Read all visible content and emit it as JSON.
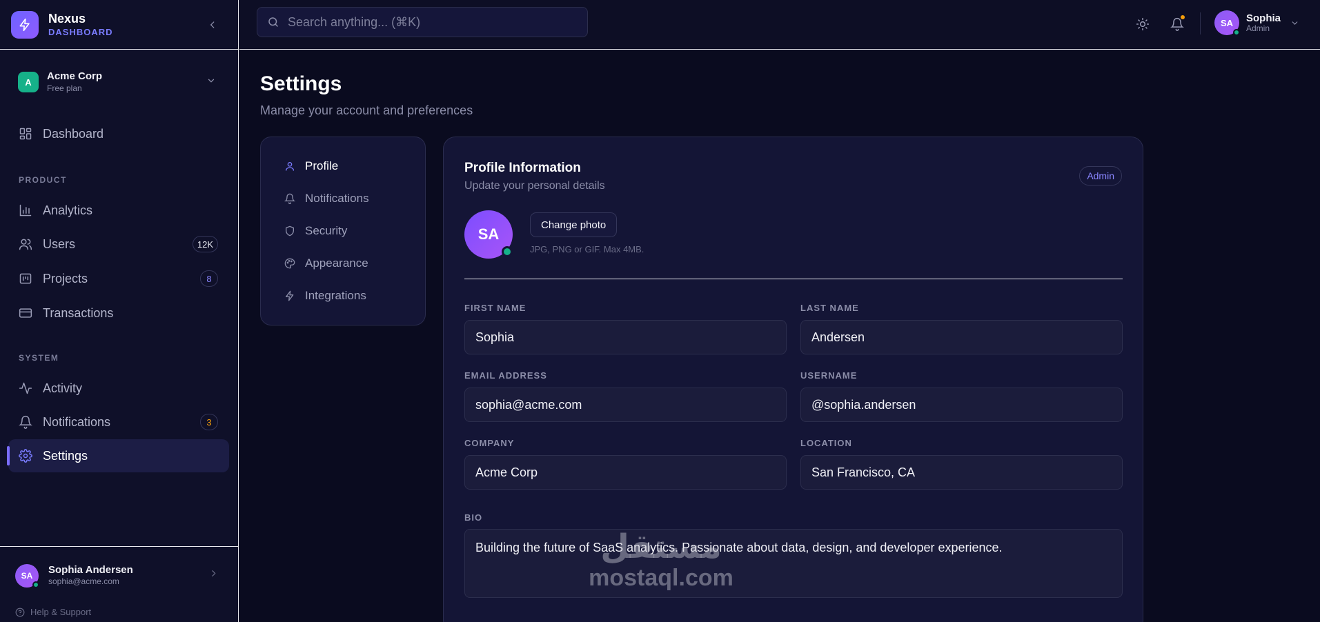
{
  "brand": {
    "name": "Nexus",
    "subtitle": "DASHBOARD"
  },
  "org": {
    "initial": "A",
    "name": "Acme Corp",
    "plan": "Free plan"
  },
  "sidebar": {
    "dashboard": "Dashboard",
    "section_product": "PRODUCT",
    "analytics": "Analytics",
    "users": "Users",
    "users_count": "12K",
    "projects": "Projects",
    "projects_count": "8",
    "transactions": "Transactions",
    "section_system": "SYSTEM",
    "activity": "Activity",
    "notifications": "Notifications",
    "notifications_count": "3",
    "settings": "Settings"
  },
  "sidebar_user": {
    "initials": "SA",
    "name": "Sophia Andersen",
    "email": "sophia@acme.com"
  },
  "help": "Help & Support",
  "topbar": {
    "search_placeholder": "Search anything... (⌘K)",
    "user_initials": "SA",
    "user_name": "Sophia",
    "user_role": "Admin"
  },
  "page": {
    "title": "Settings",
    "subtitle": "Manage your account and preferences"
  },
  "settings_nav": [
    "Profile",
    "Notifications",
    "Security",
    "Appearance",
    "Integrations"
  ],
  "profile": {
    "title": "Profile Information",
    "subtitle": "Update your personal details",
    "role_badge": "Admin",
    "avatar_initials": "SA",
    "change_photo": "Change photo",
    "photo_hint": "JPG, PNG or GIF. Max 4MB.",
    "first_name_label": "FIRST NAME",
    "first_name": "Sophia",
    "last_name_label": "LAST NAME",
    "last_name": "Andersen",
    "email_label": "EMAIL ADDRESS",
    "email": "sophia@acme.com",
    "username_label": "USERNAME",
    "username": "@sophia.andersen",
    "company_label": "COMPANY",
    "company": "Acme Corp",
    "location_label": "LOCATION",
    "location": "San Francisco, CA",
    "bio_label": "BIO",
    "bio": "Building the future of SaaS analytics. Passionate about data, design, and developer experience."
  },
  "watermark": {
    "arabic": "مستقل",
    "latin": "mostaql.com"
  },
  "colors": {
    "accent": "#7a6dff",
    "online": "#16b189",
    "badge_users": "#e6e7f0",
    "badge_projects": "#8a86ff",
    "badge_notifications": "#f59e0b"
  }
}
